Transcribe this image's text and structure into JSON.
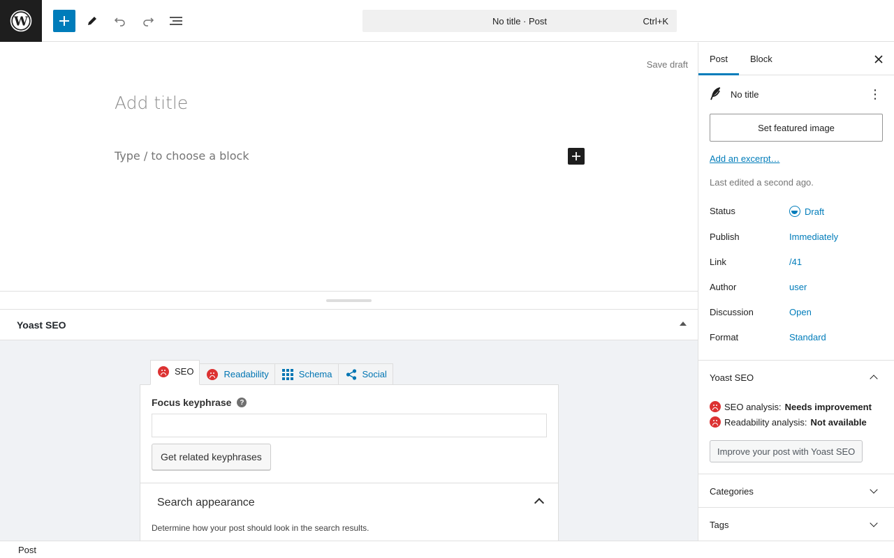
{
  "topbar": {
    "command_title": "No title · Post",
    "command_shortcut": "Ctrl+K"
  },
  "editor": {
    "save_draft": "Save draft",
    "title_placeholder": "Add title",
    "block_placeholder": "Type / to choose a block"
  },
  "metabox": {
    "title": "Yoast SEO",
    "tabs": [
      {
        "label": "SEO",
        "icon": "sad-face-icon"
      },
      {
        "label": "Readability",
        "icon": "sad-face-icon"
      },
      {
        "label": "Schema",
        "icon": "grid-icon"
      },
      {
        "label": "Social",
        "icon": "share-icon"
      }
    ],
    "focus_keyphrase_label": "Focus keyphrase",
    "focus_keyphrase_value": "",
    "related_button": "Get related keyphrases",
    "search_appearance_title": "Search appearance",
    "search_appearance_desc": "Determine how your post should look in the search results."
  },
  "statusbar": {
    "breadcrumb": "Post"
  },
  "sidebar": {
    "tabs": [
      "Post",
      "Block"
    ],
    "post_title": "No title",
    "featured_image_button": "Set featured image",
    "excerpt_link": "Add an excerpt…",
    "last_edited": "Last edited a second ago.",
    "properties": [
      {
        "label": "Status",
        "value": "Draft"
      },
      {
        "label": "Publish",
        "value": "Immediately"
      },
      {
        "label": "Link",
        "value": "/41"
      },
      {
        "label": "Author",
        "value": "user"
      },
      {
        "label": "Discussion",
        "value": "Open"
      },
      {
        "label": "Format",
        "value": "Standard"
      }
    ],
    "yoast": {
      "title": "Yoast SEO",
      "seo_label": "SEO analysis:",
      "seo_value": "Needs improvement",
      "readability_label": "Readability analysis:",
      "readability_value": "Not available",
      "improve_button": "Improve your post with Yoast SEO"
    },
    "categories_title": "Categories",
    "tags_title": "Tags"
  },
  "colors": {
    "accent": "#007cba",
    "yoast_link": "#0075b3",
    "error": "#dc3232"
  }
}
